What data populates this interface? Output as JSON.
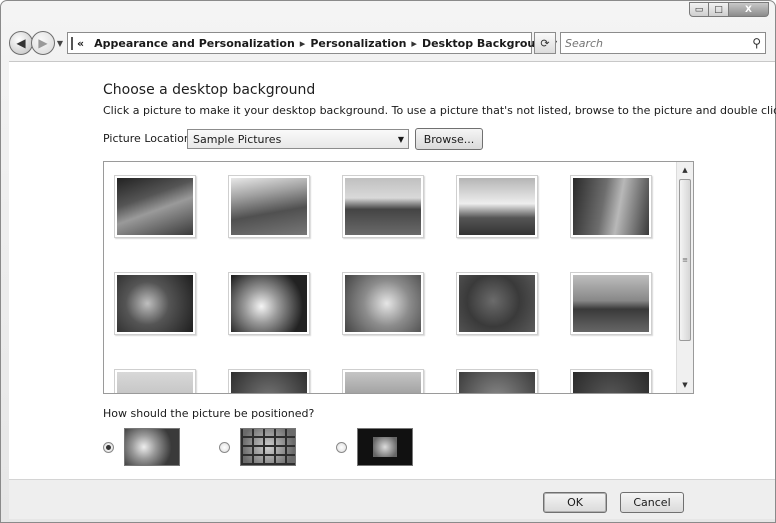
{
  "window": {
    "minimize_glyph": "▭",
    "maximize_glyph": "□",
    "close_glyph": "X"
  },
  "address": {
    "chevron": "«",
    "separator": "▸",
    "crumbs": [
      "Appearance and Personalization",
      "Personalization",
      "Desktop Background"
    ]
  },
  "search": {
    "placeholder": "Search"
  },
  "page": {
    "title": "Choose a desktop background",
    "description": "Click a picture to make it your desktop background. To use a picture that's not listed, browse to the picture and double click it.",
    "location_label": "Picture Location",
    "location_value": "Sample Pictures",
    "browse_label": "Browse...",
    "position_label": "How should the picture be positioned?"
  },
  "gallery": {
    "thumbnails": [
      "tree-branch",
      "field-stream",
      "desert-mesas",
      "tropical-lagoon",
      "forest-path",
      "leaves-flowers",
      "white-flowers",
      "wildflowers",
      "sea-turtle",
      "whale-tail",
      "sand-dunes",
      "jungle-foliage",
      "tree-canopy",
      "leaf-pattern",
      "tropical-leaves"
    ]
  },
  "positions": [
    {
      "name": "fill",
      "selected": true
    },
    {
      "name": "tile",
      "selected": false
    },
    {
      "name": "center",
      "selected": false
    }
  ],
  "footer": {
    "ok_label": "OK",
    "cancel_label": "Cancel"
  }
}
